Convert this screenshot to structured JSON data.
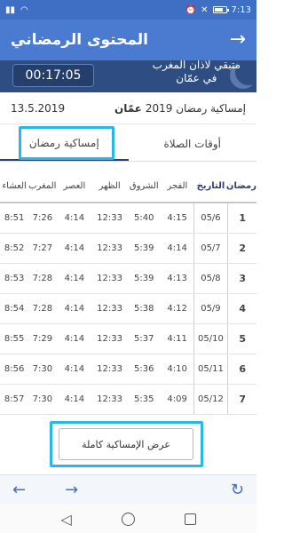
{
  "status_bar": {
    "carrier_icons": [
      "signal-icon",
      "wifi-icon"
    ],
    "right_icons": [
      "alarm-icon",
      "mute-icon"
    ],
    "battery": "47%",
    "time": "7:13"
  },
  "app_bar": {
    "title": "المحتوى الرمضاني",
    "back_icon": "→"
  },
  "banner": {
    "countdown": "00:17:05",
    "remaining_line1": "متبقي لأذان المغرب",
    "remaining_line2": "في عمّان"
  },
  "info": {
    "date": "13.5.2019",
    "label": "إمساكية رمضان 2019",
    "city": "عمّان"
  },
  "tabs": [
    {
      "label": "أوقات الصلاة",
      "active": false
    },
    {
      "label": "إمساكية رمضان",
      "active": true
    }
  ],
  "table": {
    "columns": [
      "رمضان",
      "التاريخ",
      "الفجر",
      "الشروق",
      "الظهر",
      "العصر",
      "المغرب",
      "العشاء"
    ],
    "rows": [
      [
        "1",
        "05/6",
        "4:15",
        "5:40",
        "12:33",
        "4:14",
        "7:26",
        "8:51"
      ],
      [
        "2",
        "05/7",
        "4:14",
        "5:39",
        "12:33",
        "4:14",
        "7:27",
        "8:52"
      ],
      [
        "3",
        "05/8",
        "4:13",
        "5:39",
        "12:33",
        "4:14",
        "7:28",
        "8:53"
      ],
      [
        "4",
        "05/9",
        "4:12",
        "5:38",
        "12:33",
        "4:14",
        "7:28",
        "8:54"
      ],
      [
        "5",
        "05/10",
        "4:11",
        "5:37",
        "12:33",
        "4:14",
        "7:29",
        "8:55"
      ],
      [
        "6",
        "05/11",
        "4:10",
        "5:36",
        "12:33",
        "4:14",
        "7:30",
        "8:56"
      ],
      [
        "7",
        "05/12",
        "4:09",
        "5:35",
        "12:33",
        "4:14",
        "7:30",
        "8:57"
      ]
    ]
  },
  "full_button": {
    "label": "عرض الإمساكية كاملة"
  },
  "browser_bar": {
    "back_icon": "←",
    "forward_icon": "→",
    "reload_icon": "↻"
  },
  "nav_bar": {
    "back_icon": "◁"
  },
  "colors": {
    "header": "#4a7bd0",
    "banner": "#2e4e83",
    "highlight": "#29b7e8",
    "accent": "#2b3e72"
  }
}
